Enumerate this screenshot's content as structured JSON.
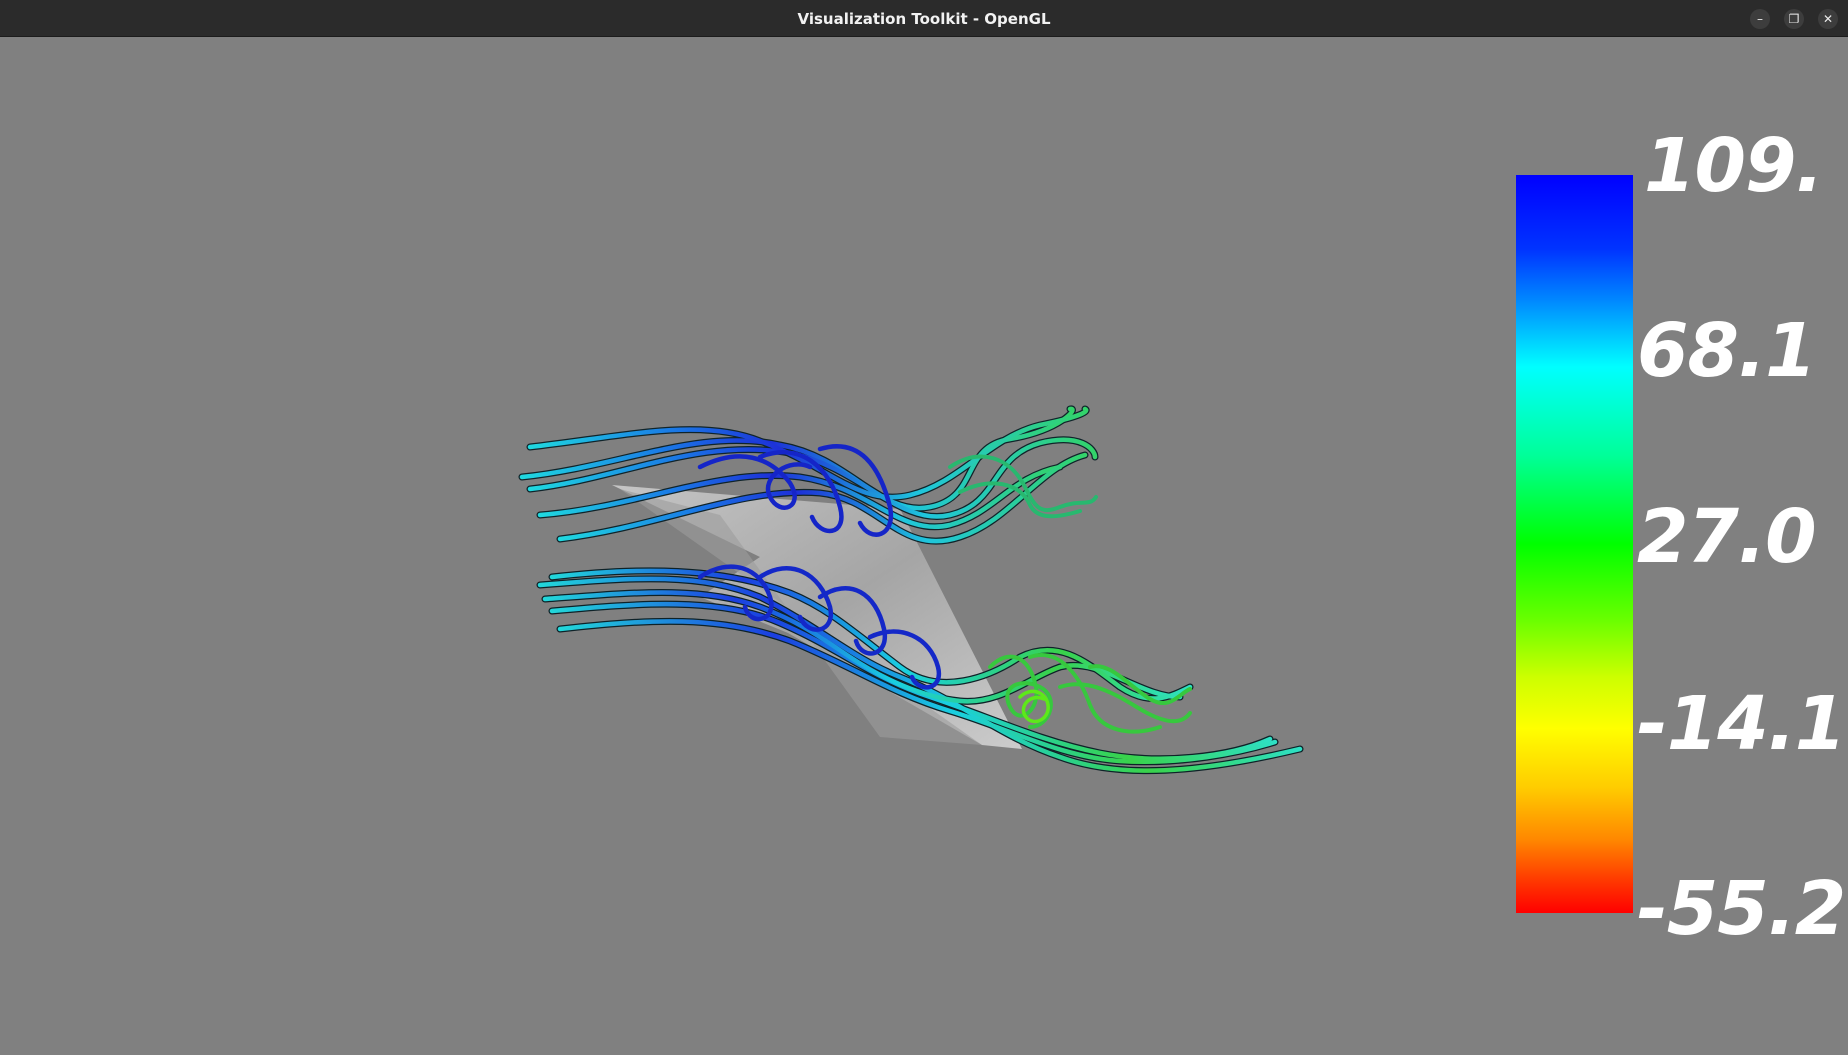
{
  "window": {
    "title": "Visualization Toolkit - OpenGL",
    "controls": {
      "minimize_icon": "minimize-icon",
      "maximize_icon": "maximize-icon",
      "close_icon": "close-icon",
      "minimize_glyph": "–",
      "maximize_glyph": "❐",
      "close_glyph": "✕"
    }
  },
  "viewport": {
    "background": "#808080"
  },
  "scalar_bar": {
    "labels": [
      "109.",
      "68.1",
      "27.0",
      "-14.1",
      "-55.2"
    ],
    "range": [
      -55.2,
      109
    ],
    "colormap": [
      "#ff0000",
      "#ffff00",
      "#00ff00",
      "#00ffff",
      "#0000ff"
    ]
  }
}
